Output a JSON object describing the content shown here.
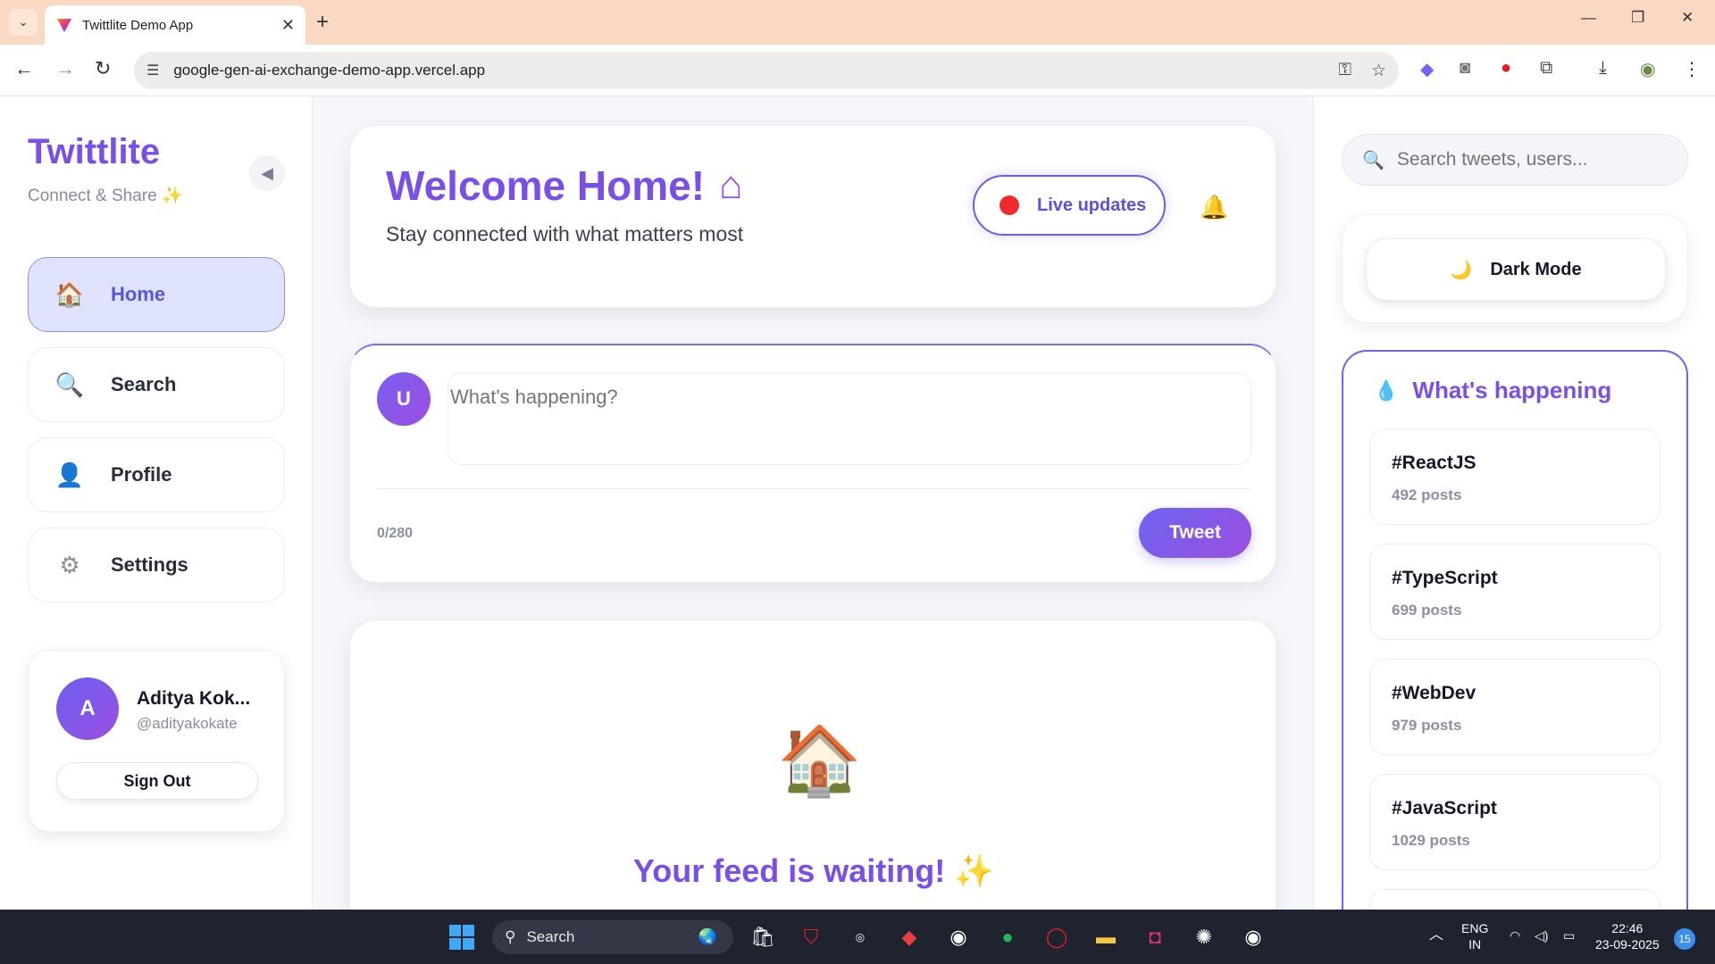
{
  "browser": {
    "tab_title": "Twittlite Demo App",
    "url": "google-gen-ai-exchange-demo-app.vercel.app"
  },
  "sidebar": {
    "brand_name": "Twittlite",
    "brand_tagline": "Connect & Share ✨",
    "collapse_icon": "◀",
    "items": [
      {
        "label": "Home",
        "icon": "🏠",
        "active": true
      },
      {
        "label": "Search",
        "icon": "🔍",
        "active": false
      },
      {
        "label": "Profile",
        "icon": "👤",
        "active": false
      },
      {
        "label": "Settings",
        "icon": "⚙",
        "active": false
      }
    ],
    "user": {
      "initial": "A",
      "name": "Aditya Kok...",
      "handle": "@adityakokate",
      "sign_out_label": "Sign Out"
    }
  },
  "main": {
    "welcome_title": "Welcome Home!",
    "welcome_icon": "🏠",
    "welcome_subtitle": "Stay connected with what matters most",
    "live_updates_label": "Live updates",
    "composer": {
      "avatar_initial": "U",
      "placeholder": "What's happening?",
      "char_count": "0/280",
      "tweet_label": "Tweet"
    },
    "feed": {
      "empty_icon": "🏠",
      "empty_title": "Your feed is waiting! ✨"
    }
  },
  "right": {
    "search_placeholder": "Search tweets, users...",
    "dark_mode_label": "Dark Mode",
    "dark_mode_icon": "🌙",
    "trends_title": "What's happening",
    "trends": [
      {
        "tag": "#ReactJS",
        "count": "492 posts"
      },
      {
        "tag": "#TypeScript",
        "count": "699 posts"
      },
      {
        "tag": "#WebDev",
        "count": "979 posts"
      },
      {
        "tag": "#JavaScript",
        "count": "1029 posts"
      }
    ]
  },
  "taskbar": {
    "search_label": "Search",
    "lang_line1": "ENG",
    "lang_line2": "IN",
    "time": "22:46",
    "date": "23-09-2025",
    "notification_count": "15"
  },
  "colors": {
    "accent": "#7a4fe8",
    "accent_blue": "#6f63f0",
    "live_dot": "#f02a2a",
    "tab_bar": "#f9d9c4"
  }
}
